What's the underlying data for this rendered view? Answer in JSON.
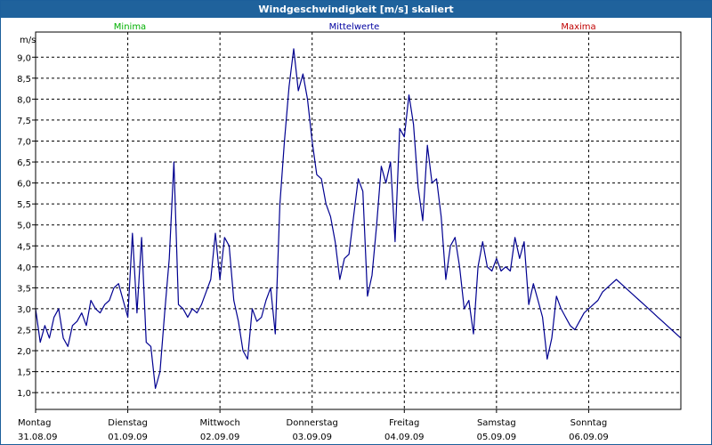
{
  "window": {
    "title": "Windgeschwindigkeit [m/s] skaliert"
  },
  "legend": [
    {
      "label": "Minima",
      "color": "#00b000"
    },
    {
      "label": "Mittelwerte",
      "color": "#0000a0"
    },
    {
      "label": "Maxima",
      "color": "#c00000"
    }
  ],
  "colors": {
    "titlebar": "#1f629c",
    "series": "#000090",
    "grid": "#000000"
  },
  "chart_data": {
    "type": "line",
    "title": "Windgeschwindigkeit [m/s] skaliert",
    "ylabel": "m/s",
    "xlabel": "",
    "ylim": [
      0.6,
      9.6
    ],
    "xlim": [
      0,
      7
    ],
    "yticks": [
      1.0,
      1.5,
      2.0,
      2.5,
      3.0,
      3.5,
      4.0,
      4.5,
      5.0,
      5.5,
      6.0,
      6.5,
      7.0,
      7.5,
      8.0,
      8.5,
      9.0
    ],
    "ytick_labels": [
      "1,0",
      "1,5",
      "2,0",
      "2,5",
      "3,0",
      "3,5",
      "4,0",
      "4,5",
      "5,0",
      "5,5",
      "6,0",
      "6,5",
      "7,0",
      "7,5",
      "8,0",
      "8,5",
      "9,0"
    ],
    "xticks": [
      {
        "day": "Montag",
        "date": "31.08.09",
        "x": 0
      },
      {
        "day": "Dienstag",
        "date": "01.09.09",
        "x": 1
      },
      {
        "day": "Mittwoch",
        "date": "02.09.09",
        "x": 2
      },
      {
        "day": "Donnerstag",
        "date": "03.09.09",
        "x": 3
      },
      {
        "day": "Freitag",
        "date": "04.09.09",
        "x": 4
      },
      {
        "day": "Samstag",
        "date": "05.09.09",
        "x": 5
      },
      {
        "day": "Sonntag",
        "date": "06.09.09",
        "x": 6
      }
    ],
    "grid": true,
    "series": [
      {
        "name": "Mittelwerte",
        "color": "#000090",
        "x": [
          0.0,
          0.05,
          0.1,
          0.15,
          0.2,
          0.25,
          0.3,
          0.35,
          0.4,
          0.45,
          0.5,
          0.55,
          0.6,
          0.65,
          0.7,
          0.75,
          0.8,
          0.85,
          0.9,
          0.95,
          1.0,
          1.05,
          1.1,
          1.15,
          1.2,
          1.25,
          1.3,
          1.35,
          1.4,
          1.45,
          1.5,
          1.55,
          1.6,
          1.65,
          1.7,
          1.75,
          1.8,
          1.85,
          1.9,
          1.95,
          2.0,
          2.05,
          2.1,
          2.15,
          2.2,
          2.25,
          2.3,
          2.35,
          2.4,
          2.45,
          2.5,
          2.55,
          2.6,
          2.65,
          2.7,
          2.75,
          2.8,
          2.85,
          2.9,
          2.95,
          3.0,
          3.05,
          3.1,
          3.15,
          3.2,
          3.25,
          3.3,
          3.35,
          3.4,
          3.45,
          3.5,
          3.55,
          3.6,
          3.65,
          3.7,
          3.75,
          3.8,
          3.85,
          3.9,
          3.95,
          4.0,
          4.05,
          4.1,
          4.15,
          4.2,
          4.25,
          4.3,
          4.35,
          4.4,
          4.45,
          4.5,
          4.55,
          4.6,
          4.65,
          4.7,
          4.75,
          4.8,
          4.85,
          4.9,
          4.95,
          5.0,
          5.05,
          5.1,
          5.15,
          5.2,
          5.25,
          5.3,
          5.35,
          5.4,
          5.45,
          5.5,
          5.55,
          5.6,
          5.65,
          5.7,
          5.75,
          5.8,
          5.85,
          5.9,
          5.95,
          6.0,
          6.05,
          6.1,
          6.15,
          6.2,
          6.25,
          6.3,
          6.35,
          6.4,
          6.45,
          6.5,
          6.55,
          6.6,
          6.65,
          6.7,
          6.75,
          6.8,
          6.85,
          6.9,
          6.95,
          7.0
        ],
        "y": [
          3.0,
          2.2,
          2.6,
          2.3,
          2.8,
          3.0,
          2.3,
          2.1,
          2.6,
          2.7,
          2.9,
          2.6,
          3.2,
          3.0,
          2.9,
          3.1,
          3.2,
          3.5,
          3.6,
          3.2,
          2.8,
          4.8,
          2.9,
          4.7,
          2.2,
          2.1,
          1.1,
          1.5,
          2.9,
          4.2,
          6.5,
          3.1,
          3.0,
          2.8,
          3.0,
          2.9,
          3.1,
          3.4,
          3.7,
          4.8,
          3.7,
          4.7,
          4.5,
          3.2,
          2.7,
          2.0,
          1.8,
          3.0,
          2.7,
          2.8,
          3.2,
          3.5,
          2.4,
          5.5,
          7.0,
          8.3,
          9.2,
          8.2,
          8.6,
          8.0,
          7.0,
          6.2,
          6.1,
          5.5,
          5.2,
          4.6,
          3.7,
          4.2,
          4.3,
          5.2,
          6.1,
          5.8,
          3.3,
          3.8,
          5.0,
          6.4,
          6.0,
          6.5,
          4.6,
          7.3,
          7.1,
          8.1,
          7.4,
          5.9,
          5.1,
          6.9,
          6.0,
          6.1,
          5.2,
          3.7,
          4.5,
          4.7,
          4.0,
          3.0,
          3.2,
          2.4,
          4.0,
          4.6,
          4.0,
          3.9,
          4.2,
          3.9,
          4.0,
          3.9,
          4.7,
          4.2,
          4.6,
          3.1,
          3.6,
          3.2,
          2.8,
          1.8,
          2.3,
          3.3,
          3.0,
          2.8,
          2.6,
          2.5,
          2.7,
          2.9,
          3.0,
          3.1,
          3.2,
          3.4,
          3.5,
          3.6,
          3.7,
          3.6,
          3.5,
          3.4,
          3.3,
          3.2,
          3.1,
          3.0,
          2.9,
          2.8,
          2.7,
          2.6,
          2.5,
          2.4,
          2.3
        ]
      }
    ]
  }
}
